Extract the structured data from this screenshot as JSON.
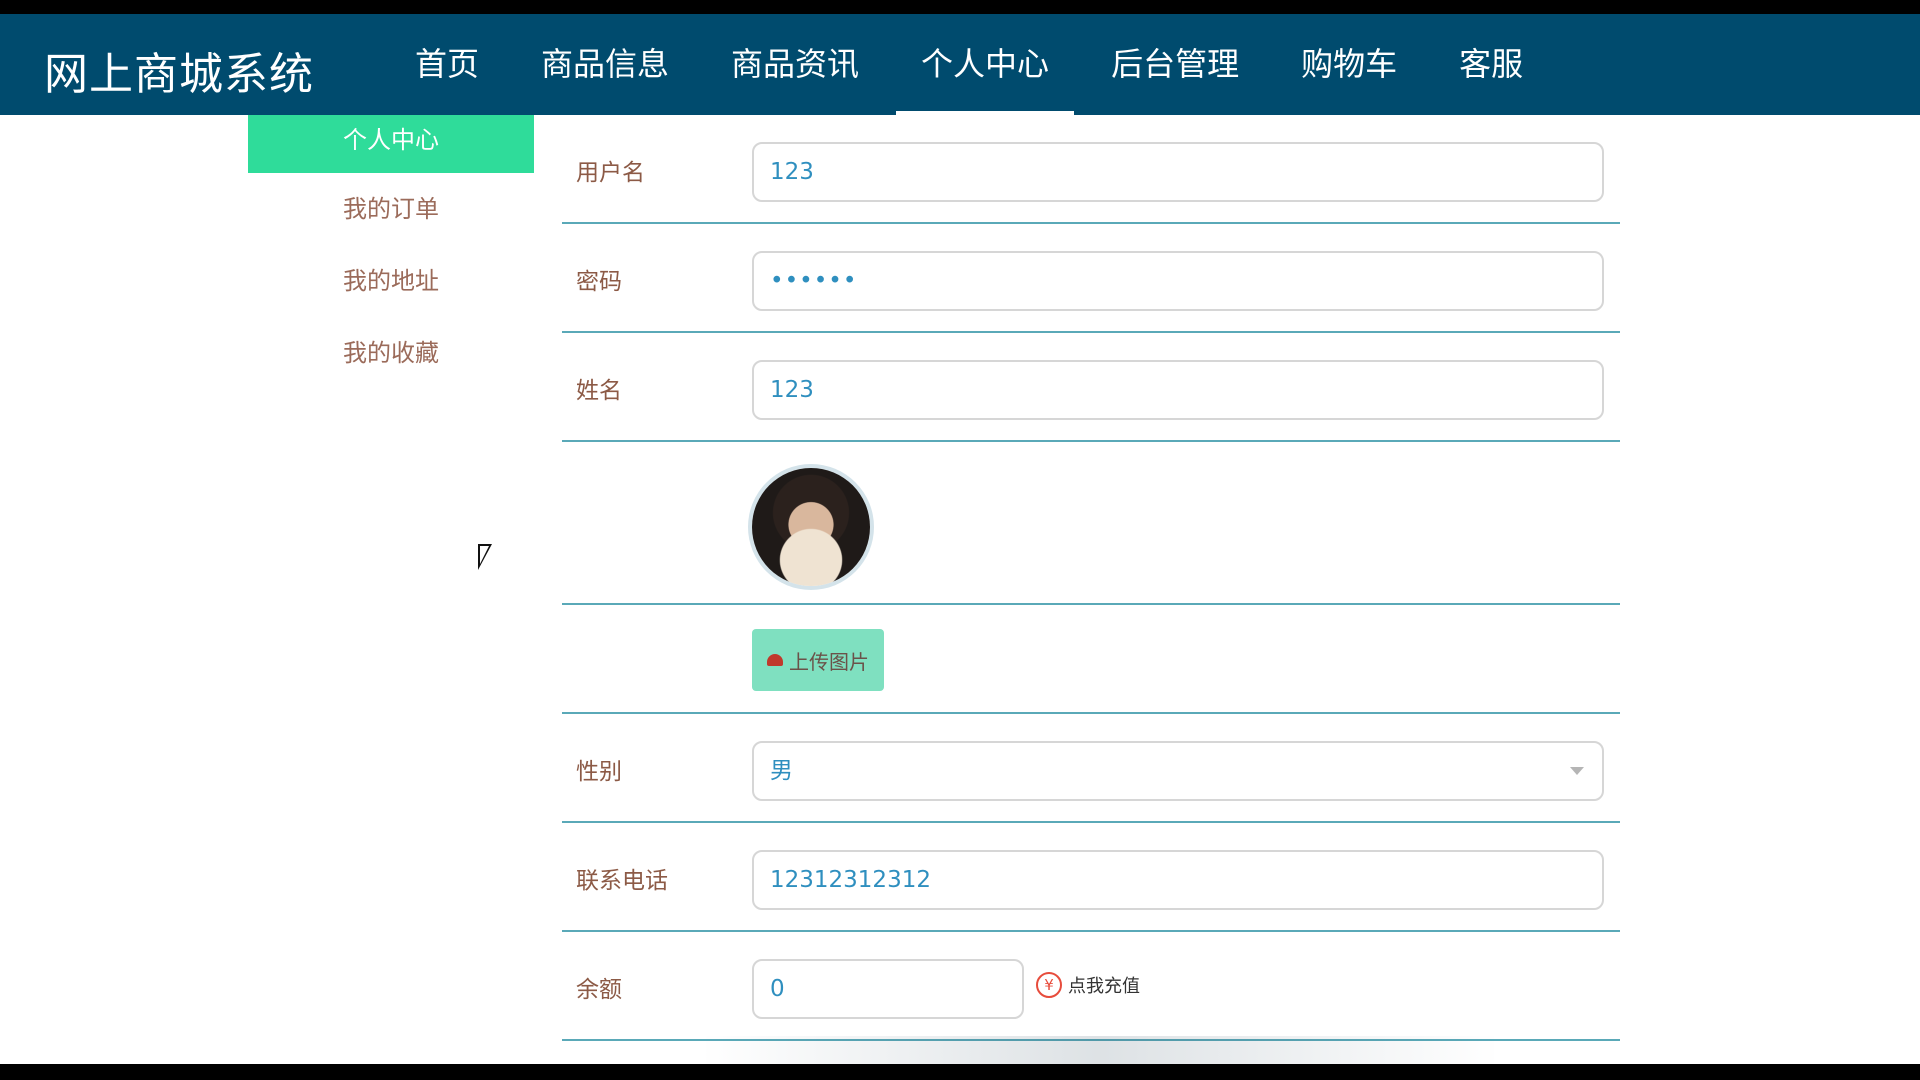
{
  "header": {
    "brand": "网上商城系统",
    "nav": [
      {
        "label": "首页",
        "active": false
      },
      {
        "label": "商品信息",
        "active": false
      },
      {
        "label": "商品资讯",
        "active": false
      },
      {
        "label": "个人中心",
        "active": true
      },
      {
        "label": "后台管理",
        "active": false
      },
      {
        "label": "购物车",
        "active": false
      },
      {
        "label": "客服",
        "active": false
      }
    ]
  },
  "sidebar": {
    "items": [
      {
        "label": "个人中心",
        "active": true
      },
      {
        "label": "我的订单",
        "active": false
      },
      {
        "label": "我的地址",
        "active": false
      },
      {
        "label": "我的收藏",
        "active": false
      }
    ]
  },
  "form": {
    "username": {
      "label": "用户名",
      "value": "123"
    },
    "password": {
      "label": "密码",
      "value": "••••••"
    },
    "name": {
      "label": "姓名",
      "value": "123"
    },
    "upload_button": "上传图片",
    "gender": {
      "label": "性别",
      "value": "男"
    },
    "phone": {
      "label": "联系电话",
      "value": "12312312312"
    },
    "balance": {
      "label": "余额",
      "value": "0"
    },
    "recharge_label": "点我充值",
    "recharge_symbol": "¥"
  },
  "colors": {
    "topbar": "#004b6e",
    "sidebar_active": "#2fdc9a",
    "row_divider": "#5aa9b8",
    "upload_button": "#7fe0c0"
  }
}
